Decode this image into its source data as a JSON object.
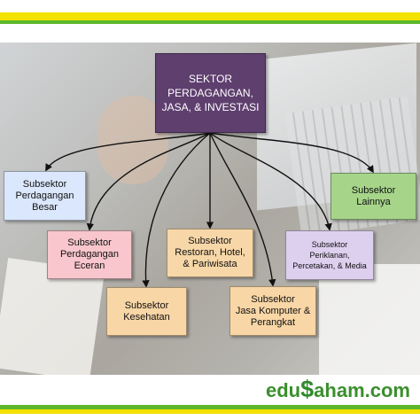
{
  "diagram": {
    "root": "SEKTOR\nPERDAGANGAN,\nJASA, & INVESTASI",
    "nodes": {
      "besar": "Subsektor\nPerdagangan\nBesar",
      "lainnya": "Subsektor\nLainnya",
      "eceran": "Subsektor\nPerdagangan\nEceran",
      "restoran": "Subsektor\nRestoran, Hotel,\n& Pariwisata",
      "periklanan": "Subsektor\nPeriklanan,\nPercetakan, & Media",
      "kesehatan": "Subsektor\nKesehatan",
      "jasa": "Subsektor\nJasa Komputer &\nPerangkat"
    }
  },
  "branding": {
    "part1": "edu",
    "dollar": "$",
    "part2": "aham.com"
  },
  "colors": {
    "root": "#5e3f6e",
    "stripe_yellow": "#f3e100",
    "stripe_green": "#5cb82a",
    "brand_green": "#3a8f2c"
  }
}
